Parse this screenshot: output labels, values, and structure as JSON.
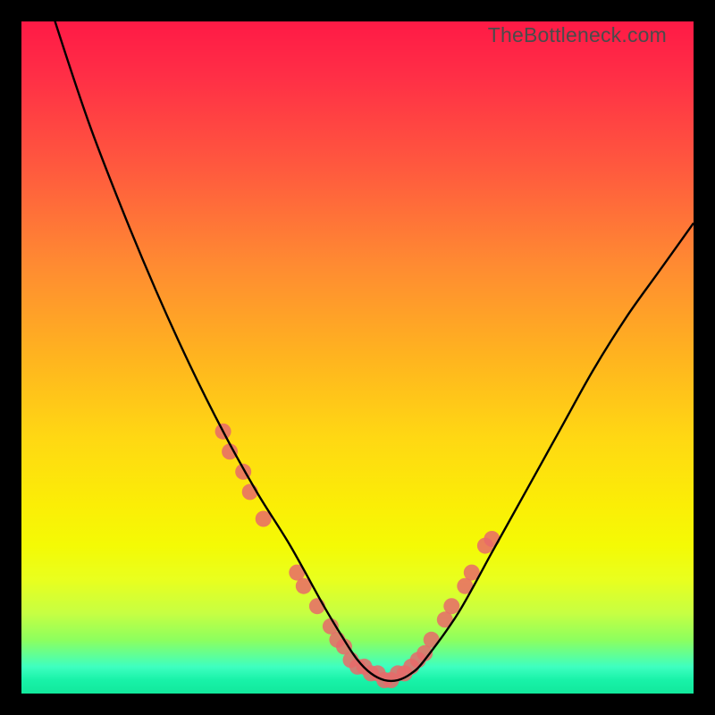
{
  "watermark": "TheBottleneck.com",
  "chart_data": {
    "type": "line",
    "title": "",
    "xlabel": "",
    "ylabel": "",
    "xlim": [
      0,
      100
    ],
    "ylim": [
      0,
      100
    ],
    "grid": false,
    "series": [
      {
        "name": "bottleneck-curve",
        "color": "#000000",
        "x": [
          0,
          5,
          10,
          15,
          20,
          25,
          30,
          35,
          40,
          45,
          48,
          50,
          52,
          54,
          56,
          58,
          60,
          65,
          70,
          75,
          80,
          85,
          90,
          95,
          100
        ],
        "values": [
          116,
          100,
          85,
          72,
          60,
          49,
          39,
          30,
          22,
          13,
          8,
          5,
          3,
          2,
          2,
          3,
          5,
          12,
          21,
          30,
          39,
          48,
          56,
          63,
          70
        ]
      }
    ],
    "markers": {
      "name": "highlight-dots",
      "color": "#e86a6a",
      "points": [
        {
          "x": 30,
          "y": 39
        },
        {
          "x": 31,
          "y": 36
        },
        {
          "x": 33,
          "y": 33
        },
        {
          "x": 34,
          "y": 30
        },
        {
          "x": 36,
          "y": 26
        },
        {
          "x": 41,
          "y": 18
        },
        {
          "x": 42,
          "y": 16
        },
        {
          "x": 44,
          "y": 13
        },
        {
          "x": 46,
          "y": 10
        },
        {
          "x": 47,
          "y": 8
        },
        {
          "x": 48,
          "y": 7
        },
        {
          "x": 49,
          "y": 5
        },
        {
          "x": 50,
          "y": 4
        },
        {
          "x": 51,
          "y": 4
        },
        {
          "x": 52,
          "y": 3
        },
        {
          "x": 53,
          "y": 3
        },
        {
          "x": 54,
          "y": 2
        },
        {
          "x": 55,
          "y": 2
        },
        {
          "x": 56,
          "y": 3
        },
        {
          "x": 57,
          "y": 3
        },
        {
          "x": 58,
          "y": 4
        },
        {
          "x": 59,
          "y": 5
        },
        {
          "x": 60,
          "y": 6
        },
        {
          "x": 61,
          "y": 8
        },
        {
          "x": 63,
          "y": 11
        },
        {
          "x": 64,
          "y": 13
        },
        {
          "x": 66,
          "y": 16
        },
        {
          "x": 67,
          "y": 18
        },
        {
          "x": 69,
          "y": 22
        },
        {
          "x": 70,
          "y": 23
        }
      ]
    },
    "annotations": [
      {
        "text": "TheBottleneck.com",
        "position": "top-right"
      }
    ]
  }
}
